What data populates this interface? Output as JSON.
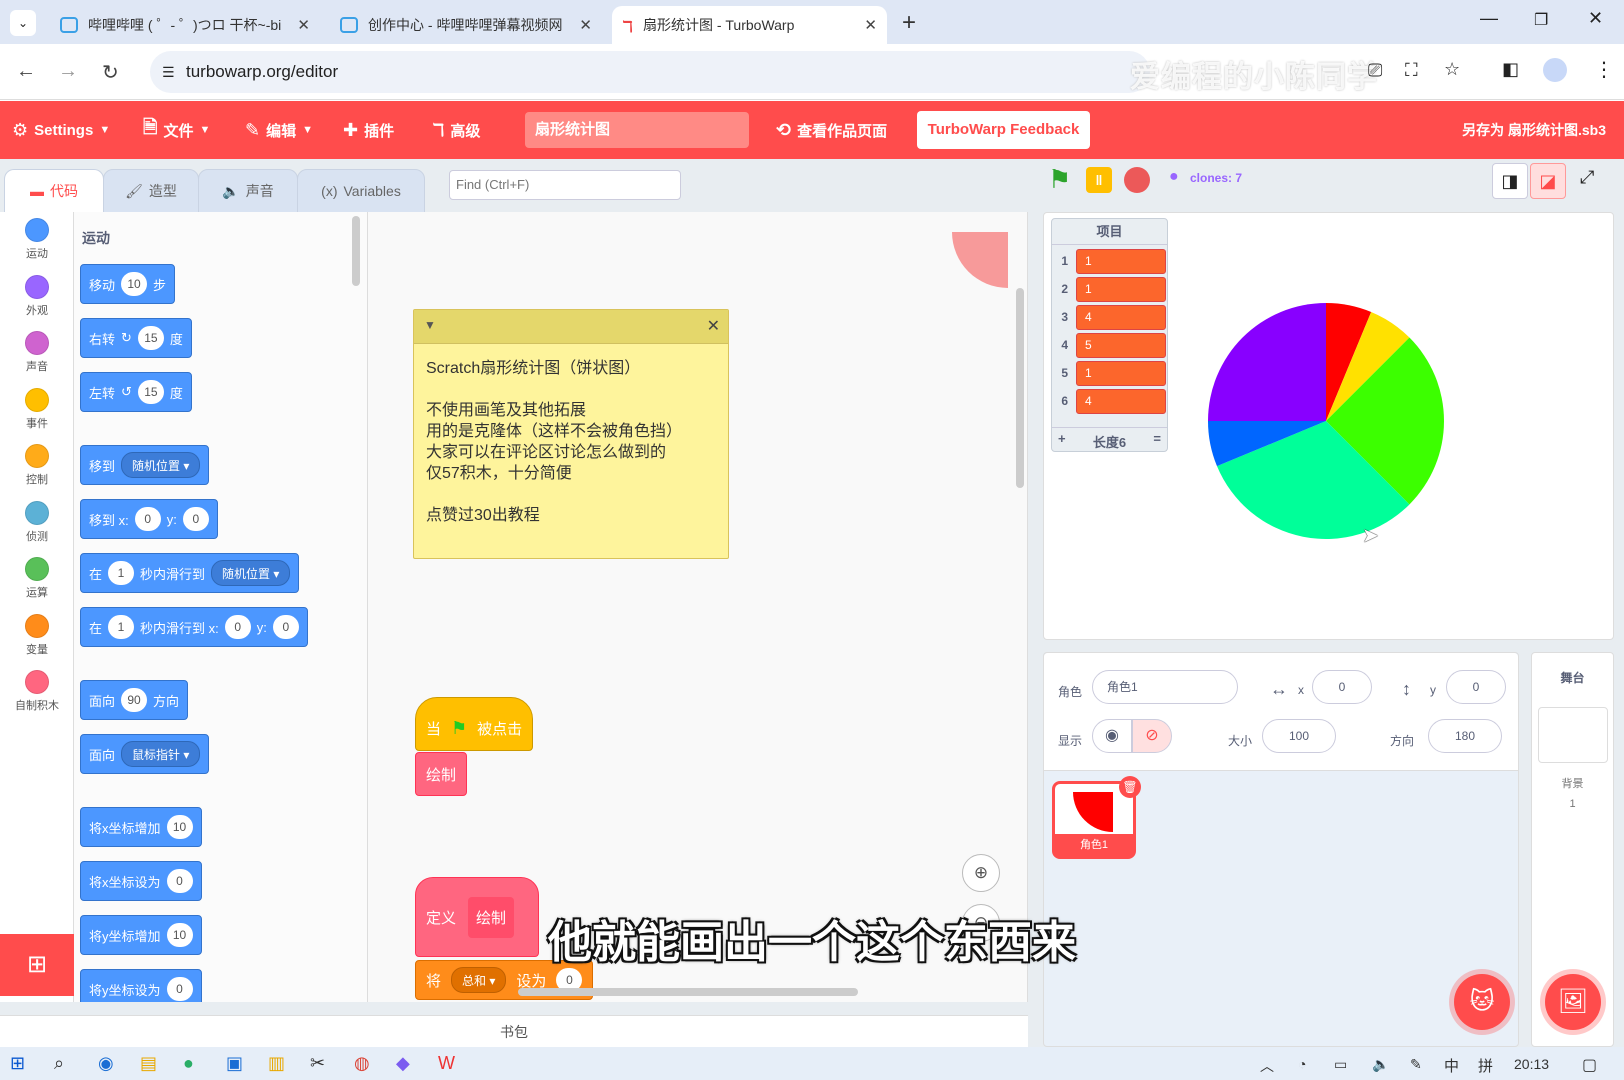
{
  "browser": {
    "tabs": [
      {
        "title": "哔哩哔哩 ( ゜- ゜)つロ 干杯~-bi"
      },
      {
        "title": "创作中心 - 哔哩哔哩弹幕视频网"
      },
      {
        "title": "扇形统计图 - TurboWarp"
      }
    ],
    "url": "turbowarp.org/editor",
    "watermark": "爱编程的小陈同学"
  },
  "menu": {
    "settings": "Settings",
    "file": "文件",
    "edit": "编辑",
    "addons": "插件",
    "advanced": "高级",
    "project_title": "扇形统计图",
    "see_page": "查看作品页面",
    "feedback": "TurboWarp Feedback",
    "save_as": "另存为 扇形统计图.sb3"
  },
  "editor_tabs": {
    "code": "代码",
    "costumes": "造型",
    "sounds": "声音",
    "variables": "Variables"
  },
  "find_placeholder": "Find (Ctrl+F)",
  "categories": [
    {
      "label": "运动",
      "color": "#4c97ff"
    },
    {
      "label": "外观",
      "color": "#9966ff"
    },
    {
      "label": "声音",
      "color": "#cf63cf"
    },
    {
      "label": "事件",
      "color": "#ffbf00"
    },
    {
      "label": "控制",
      "color": "#ffab19"
    },
    {
      "label": "侦测",
      "color": "#5cb1d6"
    },
    {
      "label": "运算",
      "color": "#59c059"
    },
    {
      "label": "变量",
      "color": "#ff8c1a"
    },
    {
      "label": "自制积木",
      "color": "#ff6680"
    }
  ],
  "palette": {
    "section": "运动",
    "move": {
      "a": "移动",
      "n": "10",
      "b": "步"
    },
    "turn_right": {
      "a": "右转",
      "n": "15",
      "b": "度"
    },
    "turn_left": {
      "a": "左转",
      "n": "15",
      "b": "度"
    },
    "goto": {
      "a": "移到",
      "dd": "随机位置"
    },
    "gotoxy": {
      "a": "移到 x:",
      "x": "0",
      "yl": "y:",
      "y": "0"
    },
    "glide": {
      "a": "在",
      "n": "1",
      "b": "秒内滑行到",
      "dd": "随机位置"
    },
    "glidexy": {
      "a": "在",
      "n": "1",
      "b": "秒内滑行到 x:",
      "x": "0",
      "yl": "y:",
      "y": "0"
    },
    "point": {
      "a": "面向",
      "n": "90",
      "b": "方向"
    },
    "pointto": {
      "a": "面向",
      "dd": "鼠标指针"
    },
    "changex": {
      "a": "将x坐标增加",
      "n": "10"
    },
    "setx": {
      "a": "将x坐标设为",
      "n": "0"
    },
    "changey": {
      "a": "将y坐标增加",
      "n": "10"
    },
    "sety": {
      "a": "将y坐标设为",
      "n": "0"
    }
  },
  "note": {
    "lines": [
      "Scratch扇形统计图（饼状图）",
      "",
      "不使用画笔及其他拓展",
      "用的是克隆体（这样不会被角色挡）",
      "大家可以在评论区讨论怎么做到的",
      "仅57积木，十分简便",
      "",
      "点赞过30出教程"
    ]
  },
  "script": {
    "hat_a": "当",
    "hat_b": "被点击",
    "call": "绘制",
    "define_a": "定义",
    "define_b": "绘制",
    "set_a": "将",
    "set_var": "总和",
    "set_b": "设为",
    "set_val": "0"
  },
  "backpack": "书包",
  "stage_bar": {
    "clones": "clones: 7"
  },
  "list_monitor": {
    "title": "项目",
    "items": [
      "1",
      "1",
      "4",
      "5",
      "1",
      "4"
    ],
    "length_label": "长度6",
    "add": "+",
    "resize": "="
  },
  "chart_data": {
    "type": "pie",
    "slices": [
      {
        "value": 1,
        "color": "#ff0000"
      },
      {
        "value": 1,
        "color": "#ffe100"
      },
      {
        "value": 4,
        "color": "#3cff00"
      },
      {
        "value": 5,
        "color": "#00ff99"
      },
      {
        "value": 1,
        "color": "#0066ff"
      },
      {
        "value": 4,
        "color": "#8800ff"
      }
    ]
  },
  "sprite_info": {
    "sprite_label": "角色",
    "sprite_name": "角色1",
    "x_label": "x",
    "x": "0",
    "y_label": "y",
    "y": "0",
    "show_label": "显示",
    "size_label": "大小",
    "size": "100",
    "dir_label": "方向",
    "direction": "180"
  },
  "sprite_thumb": "角色1",
  "stage_pane": {
    "title": "舞台",
    "backdrops_label": "背景",
    "backdrops_count": "1"
  },
  "caption": "他就能画出一个这个东西来",
  "taskbar": {
    "ime1": "中",
    "ime2": "拼",
    "time": "20:13"
  }
}
